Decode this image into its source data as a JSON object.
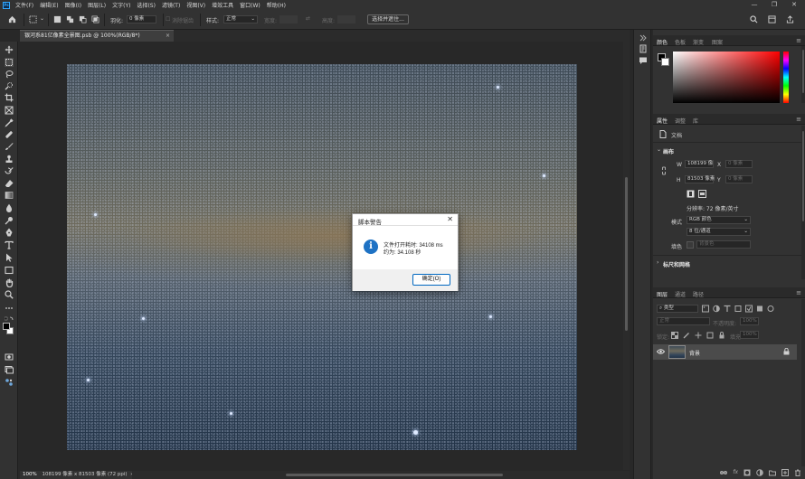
{
  "menubar": {
    "items": [
      "文件(F)",
      "编辑(E)",
      "图像(I)",
      "图层(L)",
      "文字(Y)",
      "选择(S)",
      "滤镜(T)",
      "视图(V)",
      "增效工具",
      "窗口(W)",
      "帮助(H)"
    ]
  },
  "options": {
    "feather_label": "羽化:",
    "feather_value": "0 像素",
    "antialias_label": "消除锯齿",
    "style_label": "样式:",
    "style_value": "正常",
    "width_label": "宽度:",
    "height_label": "高度:",
    "select_subject_label": "选择并遮住..."
  },
  "document": {
    "tab_title": "银河系81亿像素全景图.psb @ 100%(RGB/8*)",
    "close_glyph": "×"
  },
  "status": {
    "zoom": "100%",
    "info": "108199 像素 x 81503 像素 (72 ppi)"
  },
  "dialog": {
    "title": "脚本警告",
    "close_glyph": "✕",
    "info_glyph": "i",
    "line1": "文件打开耗时: 34108 ms",
    "line2": "约为: 34.108 秒",
    "ok_label": "确定(O)"
  },
  "color_panel": {
    "tabs": [
      "颜色",
      "色板",
      "渐变",
      "图案"
    ]
  },
  "properties_panel": {
    "tabs": [
      "属性",
      "调整",
      "库"
    ],
    "doc_label": "文档",
    "canvas_section": "画布",
    "w_label": "W",
    "w_value": "108199 像",
    "h_label": "H",
    "h_value": "81503 像素",
    "x_label": "X",
    "x_value": "0 像素",
    "y_label": "Y",
    "y_value": "0 像素",
    "resolution": "分辨率: 72 像素/英寸",
    "mode_label": "模式",
    "mode_value": "RGB 颜色",
    "depth_value": "8 位/通道",
    "fill_label": "填色",
    "fill_value": "背景色",
    "rulers_section": "标尺和网格"
  },
  "layers_panel": {
    "tabs": [
      "图层",
      "通道",
      "路径"
    ],
    "kind_placeholder": "类型",
    "blend_mode": "正常",
    "opacity_label": "不透明度:",
    "opacity_value": "100%",
    "lock_label": "锁定:",
    "fill_label": "填充:",
    "fill_value": "100%",
    "layer_name": "背景"
  }
}
